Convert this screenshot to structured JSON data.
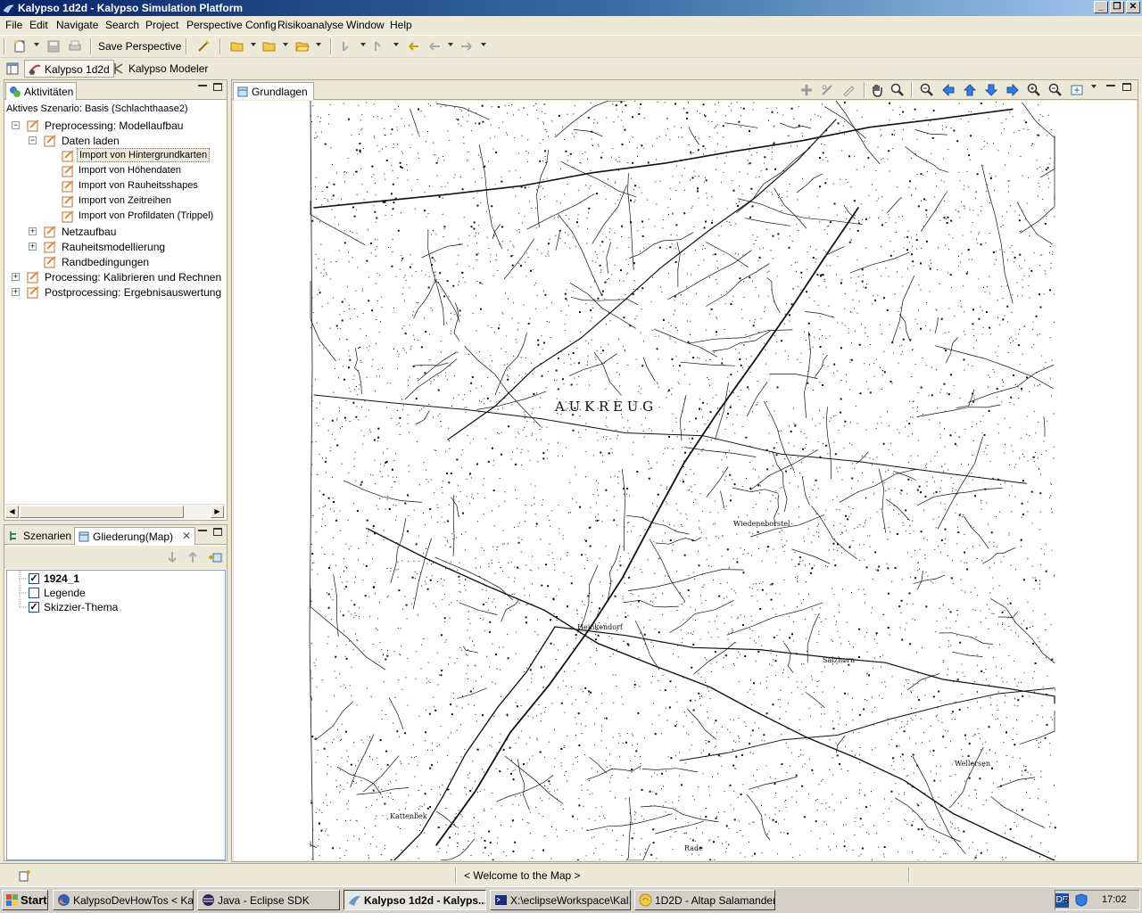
{
  "window": {
    "title": "Kalypso 1d2d - Kalypso Simulation Platform",
    "buttons": [
      "_",
      "❐",
      "✕"
    ]
  },
  "menu": [
    "File",
    "Edit",
    "Navigate",
    "Search",
    "Project",
    "Perspective Config",
    "Risikoanalyse",
    "Window",
    "Help"
  ],
  "toolbar": {
    "save_perspective_label": "Save Perspective"
  },
  "perspectives": [
    {
      "label": "Kalypso 1d2d",
      "active": true
    },
    {
      "label": "Kalypso Modeler",
      "active": false
    }
  ],
  "activities": {
    "tab_label": "Aktivitäten",
    "scenario_text": "Aktives Szenario: Basis (Schlachthaase2)",
    "tree": [
      {
        "label": "Preprocessing: Modellaufbau",
        "expander": "−"
      },
      {
        "label": "Daten laden",
        "expander": "−"
      },
      {
        "label": "Import von Hintergrundkarten",
        "selected": true
      },
      {
        "label": "Import von Höhendaten"
      },
      {
        "label": "Import von Rauheitsshapes"
      },
      {
        "label": "Import von Zeitreihen"
      },
      {
        "label": "Import von Profildaten (Trippel)"
      },
      {
        "label": "Netzaufbau",
        "expander": "+"
      },
      {
        "label": "Rauheitsmodellierung",
        "expander": "+"
      },
      {
        "label": "Randbedingungen"
      },
      {
        "label": "Processing: Kalibrieren und Rechnen",
        "expander": "+"
      },
      {
        "label": "Postprocessing: Ergebnisauswertung",
        "expander": "+"
      }
    ]
  },
  "outline": {
    "tab_scenarios": "Szenarien",
    "tab_outline": "Gliederung(Map)",
    "layers": [
      {
        "label": "1924_1",
        "checked": true,
        "bold": true
      },
      {
        "label": "Legende",
        "checked": false,
        "bold": false
      },
      {
        "label": "Skizzier-Thema",
        "checked": true,
        "bold": false
      }
    ]
  },
  "map": {
    "tab_label": "Grundlagen",
    "place_labels": [
      {
        "text": "A   U   K   R   E   U   G"
      },
      {
        "text": "Wiedeneborstel"
      },
      {
        "text": "Heinkendorf"
      },
      {
        "text": "Salzhorn"
      },
      {
        "text": "Kattenbek"
      },
      {
        "text": "Wellersen"
      },
      {
        "text": "Rade"
      }
    ]
  },
  "status": {
    "message": "< Welcome to the Map >"
  },
  "taskbar": {
    "start_label": "Start",
    "tasks": [
      {
        "label": "KalypsoDevHowTos < Ka...",
        "active": false
      },
      {
        "label": "Java - Eclipse SDK",
        "active": false
      },
      {
        "label": "Kalypso 1d2d - Kalyps...",
        "active": true
      },
      {
        "label": "X:\\eclipseWorkspace\\Kal...",
        "active": false
      },
      {
        "label": "1D2D - Altap Salamander...",
        "active": false
      }
    ],
    "lang": "DE",
    "chevron": "«",
    "clock": "17:02"
  },
  "colors": {
    "title_gradient_start": "#0a246a",
    "chrome": "#ece9d8",
    "map_ink": "#111111"
  }
}
